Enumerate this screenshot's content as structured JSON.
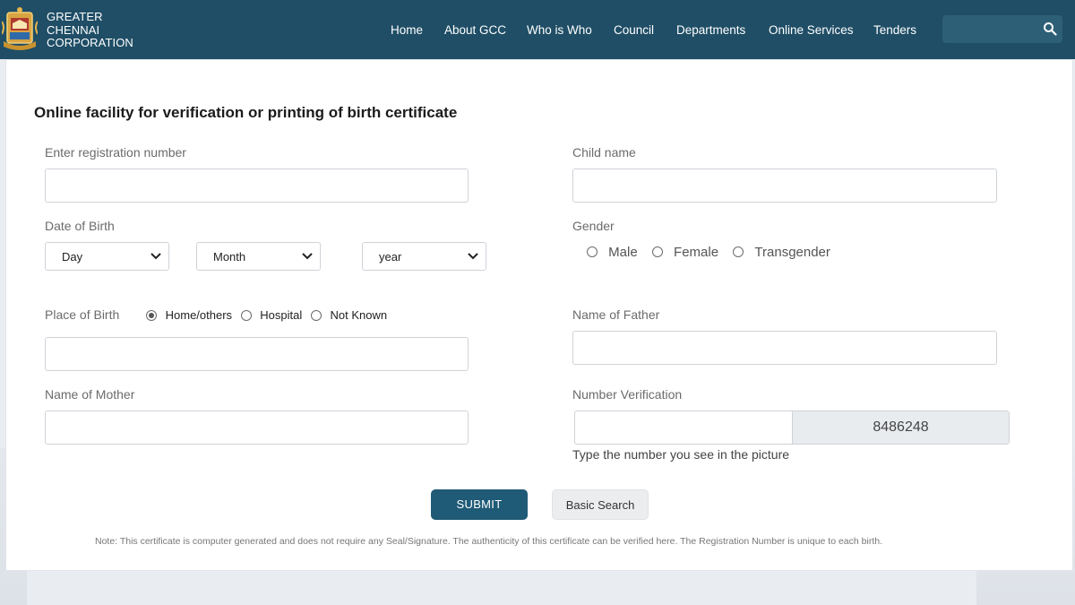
{
  "brand": {
    "line1": "GREATER",
    "line2": "CHENNAI",
    "line3": "CORPORATION"
  },
  "nav": {
    "items": [
      {
        "label": "Home"
      },
      {
        "label": "About GCC"
      },
      {
        "label": "Who is Who"
      },
      {
        "label": "Council"
      },
      {
        "label": "Departments"
      },
      {
        "label": "Online Services"
      },
      {
        "label": "Tenders"
      }
    ],
    "search_icon": "search-icon"
  },
  "form": {
    "title": "Online facility for verification or printing of birth certificate",
    "registration_label": "Enter registration number",
    "child_name_label": "Child name",
    "dob_label": "Date of Birth",
    "day_select": "Day",
    "month_select": "Month",
    "year_select": "year",
    "gender_label": "Gender",
    "gender_options": [
      "Male",
      "Female",
      "Transgender"
    ],
    "place_label": "Place of Birth",
    "place_options": [
      "Home/others",
      "Hospital",
      "Not Known"
    ],
    "place_selected": "Home/others",
    "father_label": "Name of Father",
    "mother_label": "Name of Mother",
    "number_verification_label": "Number Verification",
    "captcha_value": "8486248",
    "captcha_hint": "Type the number you see in the picture",
    "submit_label": "SUBMIT",
    "basic_search_label": "Basic Search",
    "note": "Note: This certificate is computer generated and does not require any Seal/Signature. The authenticity of this certificate can be verified here. The Registration Number is unique to each birth."
  },
  "colors": {
    "header_bg": "#1f4e66",
    "submit_bg": "#1f5a76",
    "captcha_bg": "#e9ecef"
  }
}
